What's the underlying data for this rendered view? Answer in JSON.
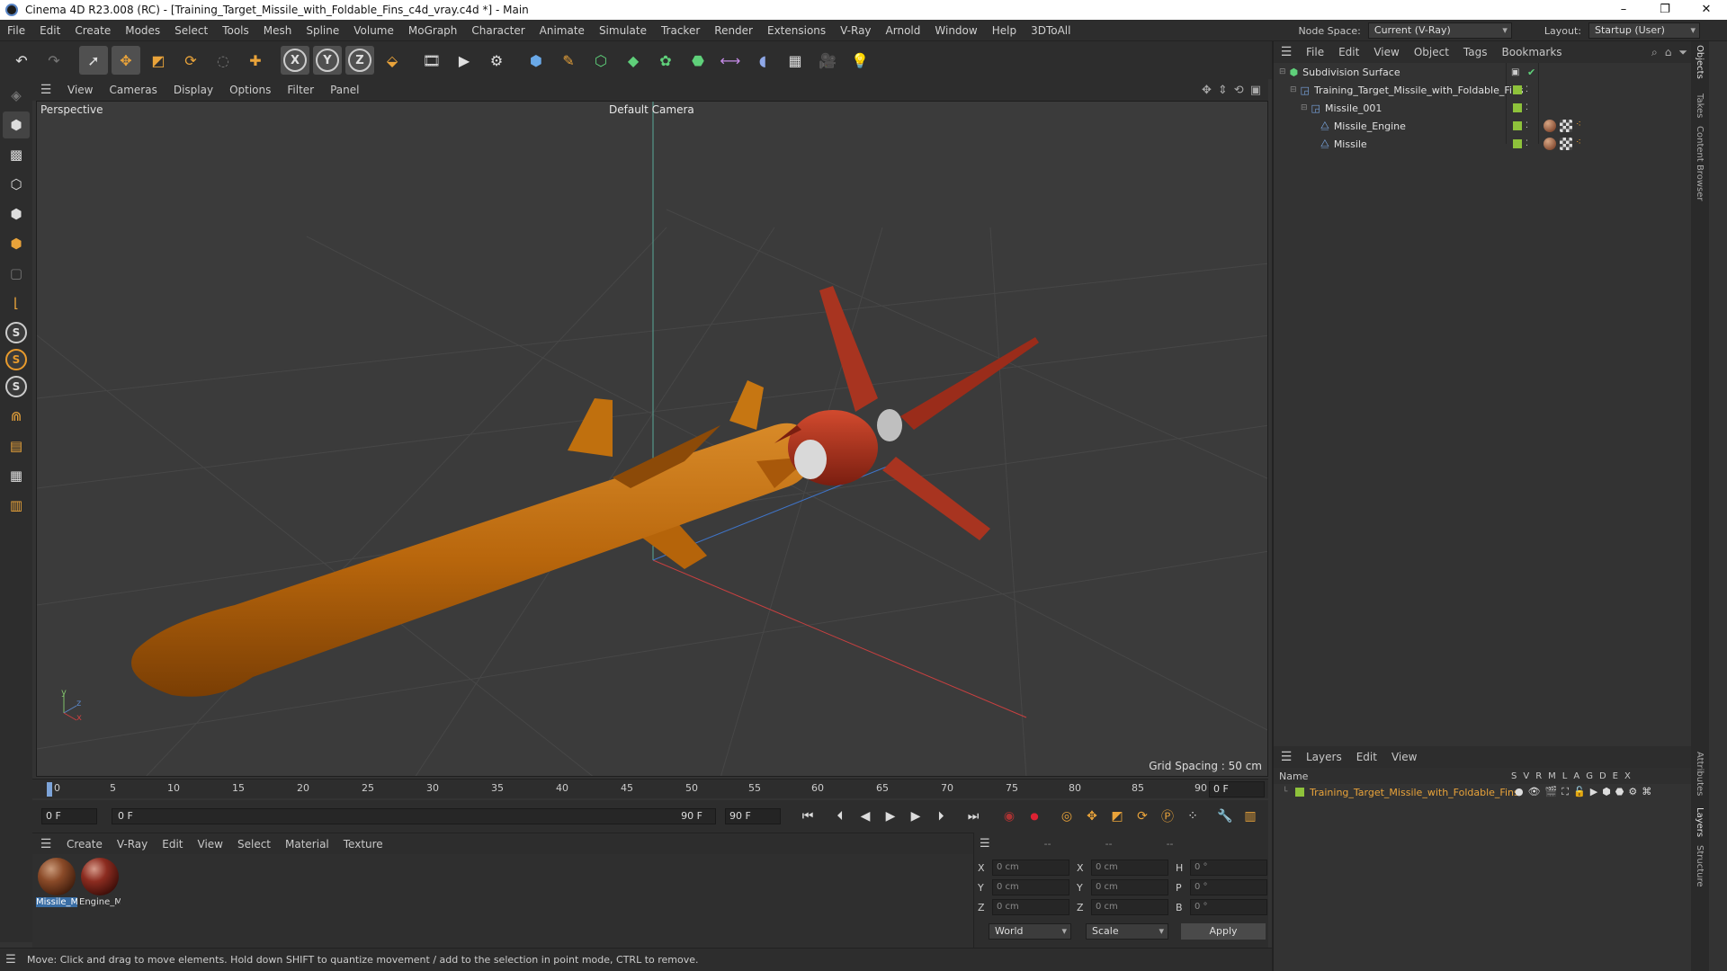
{
  "titlebar": {
    "title": "Cinema 4D R23.008 (RC) - [Training_Target_Missile_with_Foldable_Fins_c4d_vray.c4d *] - Main",
    "minimize": "–",
    "maximize": "❐",
    "close": "✕"
  },
  "menu": [
    "File",
    "Edit",
    "Create",
    "Modes",
    "Select",
    "Tools",
    "Mesh",
    "Spline",
    "Volume",
    "MoGraph",
    "Character",
    "Animate",
    "Simulate",
    "Tracker",
    "Render",
    "Extensions",
    "V-Ray",
    "Arnold",
    "Window",
    "Help",
    "3DToAll"
  ],
  "node_space": {
    "label": "Node Space:",
    "value": "Current (V-Ray)"
  },
  "layout": {
    "label": "Layout:",
    "value": "Startup (User)"
  },
  "toolbar": {
    "icons": [
      "undo-icon",
      "redo-icon",
      "select-arrow-icon",
      "move-icon",
      "scale-icon",
      "rotate-icon",
      "lasso-icon",
      "add-icon",
      "x-axis-icon",
      "y-axis-icon",
      "z-axis-icon",
      "coordinate-system-icon",
      "render-region-icon",
      "render-view-icon",
      "render-settings-icon",
      "cube-icon",
      "pen-icon",
      "subdivision-icon",
      "extrude-icon",
      "cloner-icon",
      "boole-icon",
      "symmetry-icon",
      "deformer-icon",
      "floor-icon",
      "camera-icon",
      "light-icon"
    ],
    "axis_x": "X",
    "axis_y": "Y",
    "axis_z": "Z"
  },
  "viewport": {
    "menu": [
      "View",
      "Cameras",
      "Display",
      "Options",
      "Filter",
      "Panel"
    ],
    "label": "Perspective",
    "camera": "Default Camera",
    "grid_spacing": "Grid Spacing : 50 cm",
    "axis_y": "y",
    "axis_z": "z",
    "axis_x": "x"
  },
  "timeline": {
    "ticks": [
      "0",
      "5",
      "10",
      "15",
      "20",
      "25",
      "30",
      "35",
      "40",
      "45",
      "50",
      "55",
      "60",
      "65",
      "70",
      "75",
      "80",
      "85",
      "90"
    ],
    "current_frame": "0 F",
    "start": "0 F",
    "range_start": "0 F",
    "range_end": "90 F",
    "end": "90 F"
  },
  "material_manager": {
    "menu": [
      "Create",
      "V-Ray",
      "Edit",
      "View",
      "Select",
      "Material",
      "Texture"
    ],
    "materials": [
      {
        "label": "Missile_M"
      },
      {
        "label": "Engine_M"
      }
    ]
  },
  "coordinates": {
    "headers": [
      "--",
      "--",
      "--"
    ],
    "rows": [
      {
        "a": "X",
        "a_val": "0 cm",
        "b": "X",
        "b_val": "0 cm",
        "c": "H",
        "c_val": "0 °"
      },
      {
        "a": "Y",
        "a_val": "0 cm",
        "b": "Y",
        "b_val": "0 cm",
        "c": "P",
        "c_val": "0 °"
      },
      {
        "a": "Z",
        "a_val": "0 cm",
        "b": "Z",
        "b_val": "0 cm",
        "c": "B",
        "c_val": "0 °"
      }
    ],
    "mode1": "World",
    "mode2": "Scale",
    "apply": "Apply"
  },
  "status": "Move: Click and drag to move elements. Hold down SHIFT to quantize movement / add to the selection in point mode, CTRL to remove.",
  "objects": {
    "menu": [
      "File",
      "Edit",
      "View",
      "Object",
      "Tags",
      "Bookmarks"
    ],
    "items": [
      {
        "name": "Subdivision Surface"
      },
      {
        "name": "Training_Target_Missile_with_Foldable_Fins"
      },
      {
        "name": "Missile_001"
      },
      {
        "name": "Missile_Engine"
      },
      {
        "name": "Missile"
      }
    ]
  },
  "layers": {
    "menu": [
      "Layers",
      "Edit",
      "View"
    ],
    "name_header": "Name",
    "flags": [
      "S",
      "V",
      "R",
      "M",
      "L",
      "A",
      "G",
      "D",
      "E",
      "X"
    ],
    "items": [
      {
        "name": "Training_Target_Missile_with_Foldable_Fins"
      }
    ]
  },
  "side_tabs": [
    "Objects",
    "Takes",
    "Content Browser",
    "Attributes",
    "Layers",
    "Structure"
  ],
  "colors": {
    "accent": "#3a6ea5",
    "layer_green": "#8ec23b",
    "layer_orange": "#e9a33a",
    "missile_orange": "#c46d10",
    "engine_red": "#b03b22"
  }
}
